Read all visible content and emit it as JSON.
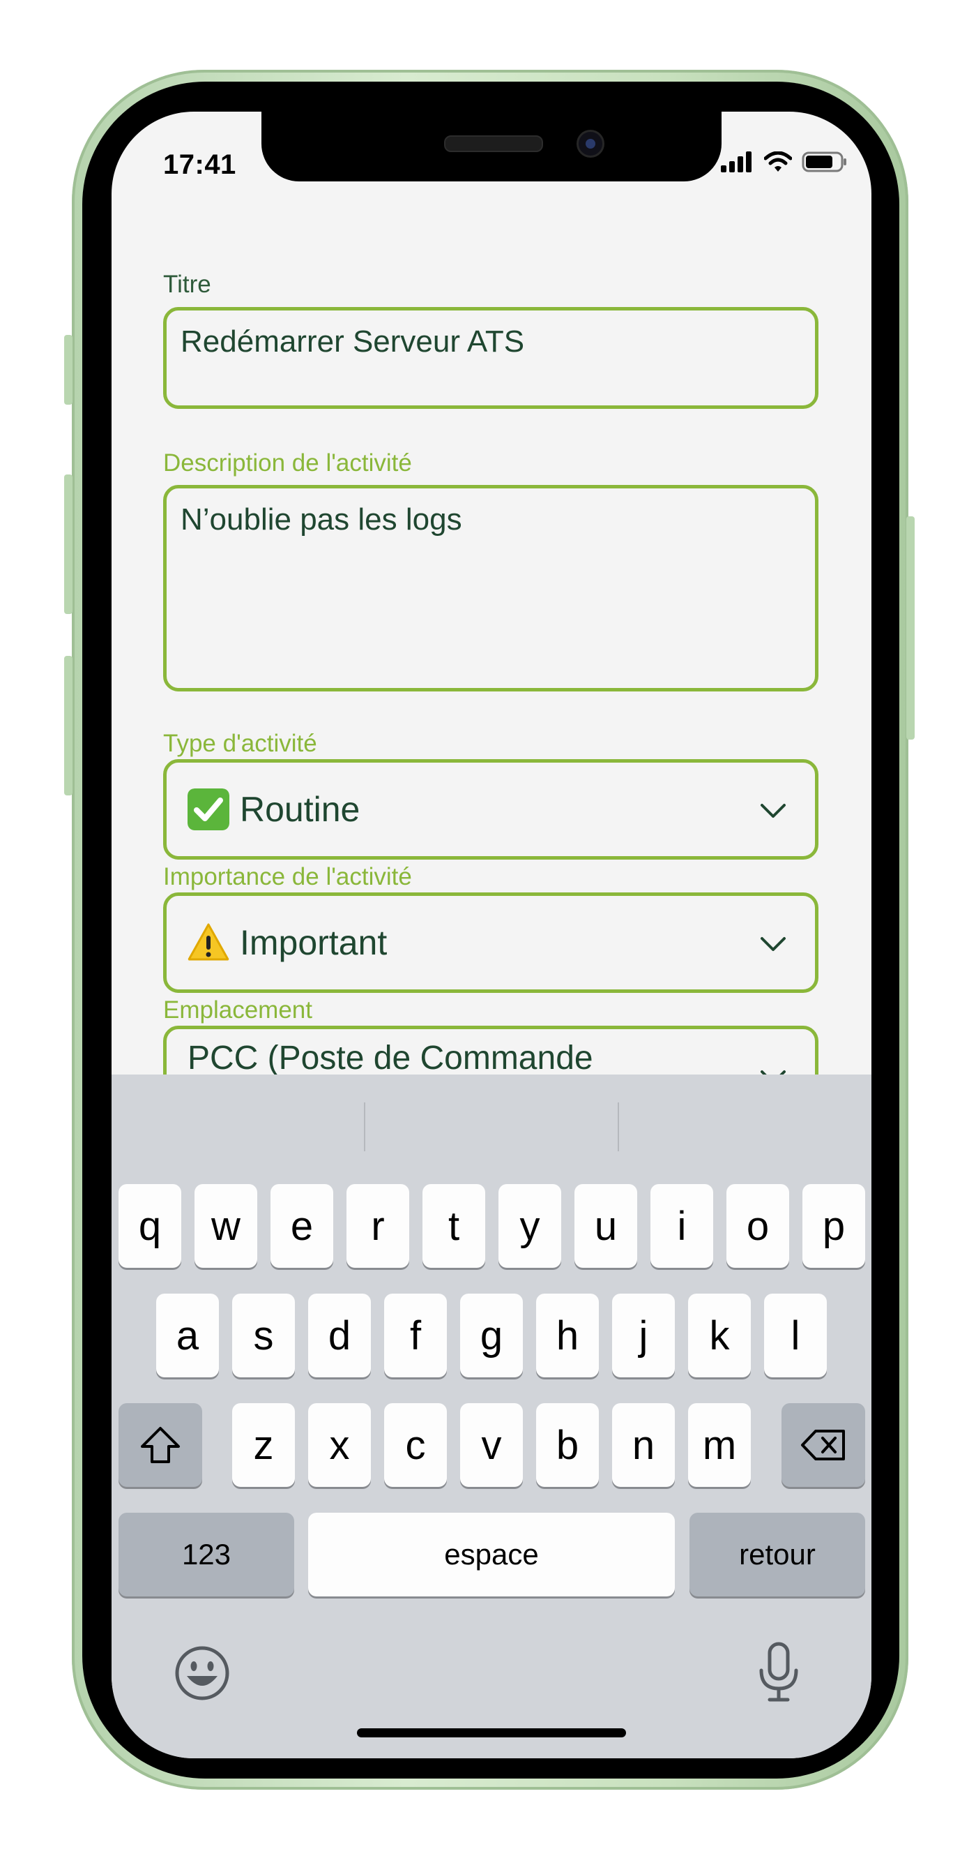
{
  "status_bar": {
    "time": "17:41",
    "icons": [
      "signal-icon",
      "wifi-icon",
      "battery-icon"
    ]
  },
  "form": {
    "title": {
      "label": "Titre",
      "value": "Redémarrer Serveur ATS"
    },
    "description": {
      "label": "Description de l'activité",
      "value": "N’oublie pas les logs"
    },
    "type": {
      "label": "Type d'activité",
      "emoji": "check-mark-button-icon",
      "value": "Routine"
    },
    "importance": {
      "label": "Importance de l'activité",
      "emoji": "warning-icon",
      "value": "Important"
    },
    "location": {
      "label": "Emplacement",
      "value": "PCC (Poste de Commande"
    }
  },
  "keyboard": {
    "row1": [
      "q",
      "w",
      "e",
      "r",
      "t",
      "y",
      "u",
      "i",
      "o",
      "p"
    ],
    "row2": [
      "a",
      "s",
      "d",
      "f",
      "g",
      "h",
      "j",
      "k",
      "l"
    ],
    "row3": [
      "z",
      "x",
      "c",
      "v",
      "b",
      "n",
      "m"
    ],
    "numbers_label": "123",
    "space_label": "espace",
    "return_label": "retour",
    "icons": [
      "shift-icon",
      "backspace-icon",
      "emoji-icon",
      "microphone-icon"
    ]
  },
  "colors": {
    "accent": "#8ab73a",
    "text": "#1f4630",
    "background": "#f4f4f4",
    "keyboard": "#d1d4d9"
  }
}
